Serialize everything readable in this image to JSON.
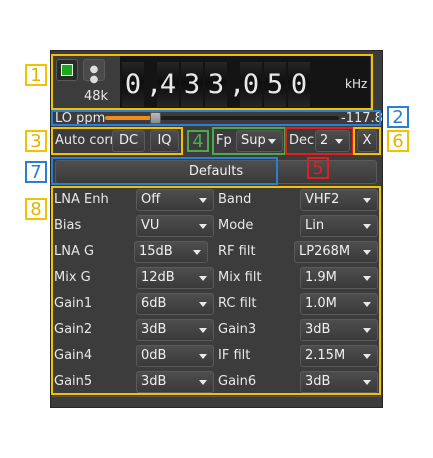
{
  "callouts": [
    "1",
    "2",
    "3",
    "4",
    "5",
    "6",
    "7",
    "8"
  ],
  "sample_rate": "48k",
  "frequency": {
    "digits": [
      "0",
      ",",
      "4",
      "3",
      "3",
      ",",
      "0",
      "5",
      "0"
    ],
    "unit": "kHz"
  },
  "lo_ppm": {
    "label": "LO ppm",
    "value": "-117.8",
    "slider_fraction": 0.12
  },
  "corrections": {
    "label": "Auto corr",
    "dc": "DC",
    "iq": "IQ"
  },
  "fp": {
    "label": "Fp",
    "value": "Sup"
  },
  "dec": {
    "label": "Dec",
    "value": "2"
  },
  "close_label": "X",
  "defaults_label": "Defaults",
  "settings_left": [
    {
      "label": "LNA Enh",
      "value": "Off"
    },
    {
      "label": "Bias",
      "value": "VU"
    },
    {
      "label": "LNA G",
      "value": "15dB"
    },
    {
      "label": "Mix G",
      "value": "12dB"
    },
    {
      "label": "Gain1",
      "value": "6dB"
    },
    {
      "label": "Gain2",
      "value": "3dB"
    },
    {
      "label": "Gain4",
      "value": "0dB"
    },
    {
      "label": "Gain5",
      "value": "3dB"
    }
  ],
  "settings_right": [
    {
      "label": "Band",
      "value": "VHF2"
    },
    {
      "label": "Mode",
      "value": "Lin"
    },
    {
      "label": "RF filt",
      "value": "LP268M"
    },
    {
      "label": "Mix filt",
      "value": "1.9M"
    },
    {
      "label": "RC filt",
      "value": "1.0M"
    },
    {
      "label": "Gain3",
      "value": "3dB"
    },
    {
      "label": "IF filt",
      "value": "2.15M"
    },
    {
      "label": "Gain6",
      "value": "3dB"
    }
  ],
  "colors": {
    "accent_yellow": "#f2c200",
    "accent_blue": "#2a7fd4",
    "accent_green": "#4fa84f",
    "accent_red": "#e02020",
    "start_green": "#1fa81f"
  }
}
